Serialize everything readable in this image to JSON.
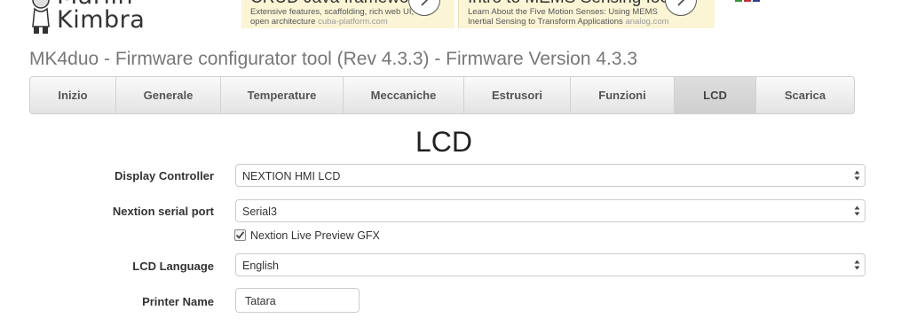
{
  "header": {
    "logo_line1": "Marlin",
    "logo_line2": "Kimbra",
    "ads": [
      {
        "title": "CRUD Java framework",
        "line1": "Extensive features, scaffolding, rich web UI,",
        "line2": "open architecture",
        "domain": "cuba-platform.com"
      },
      {
        "title": "Intro to MEMS Sensing IoS",
        "line1": "Learn About the Five Motion Senses: Using MEMS",
        "line2": "Inertial Sensing to Transform Applications",
        "domain": "analog.com"
      }
    ]
  },
  "page_title": "MK4duo - Firmware configurator tool (Rev 4.3.3) - Firmware Version 4.3.3",
  "tabs": [
    {
      "label": "Inizio"
    },
    {
      "label": "Generale"
    },
    {
      "label": "Temperature"
    },
    {
      "label": "Meccaniche"
    },
    {
      "label": "Estrusori"
    },
    {
      "label": "Funzioni"
    },
    {
      "label": "LCD"
    },
    {
      "label": "Scarica"
    }
  ],
  "active_tab": "LCD",
  "section_title": "LCD",
  "form": {
    "display_controller": {
      "label": "Display Controller",
      "value": "NEXTION HMI LCD"
    },
    "nextion_serial_port": {
      "label": "Nextion serial port",
      "value": "Serial3"
    },
    "nextion_live_preview": {
      "label": "Nextion Live Preview GFX",
      "checked": true
    },
    "lcd_language": {
      "label": "LCD Language",
      "value": "English"
    },
    "printer_name": {
      "label": "Printer Name",
      "value": "Tatara"
    }
  },
  "icons": {
    "ad_arrow": "chevron-right-icon",
    "select_arrows": "up-down-arrows-icon",
    "checkbox": "check-icon"
  },
  "colors": {
    "page_title": "#777777",
    "tab_bg": "#e3e3e3",
    "tab_active_bg": "#cfcfcf",
    "ad_bg": "#fbf5d6",
    "checkbox_mark": "#444444"
  }
}
